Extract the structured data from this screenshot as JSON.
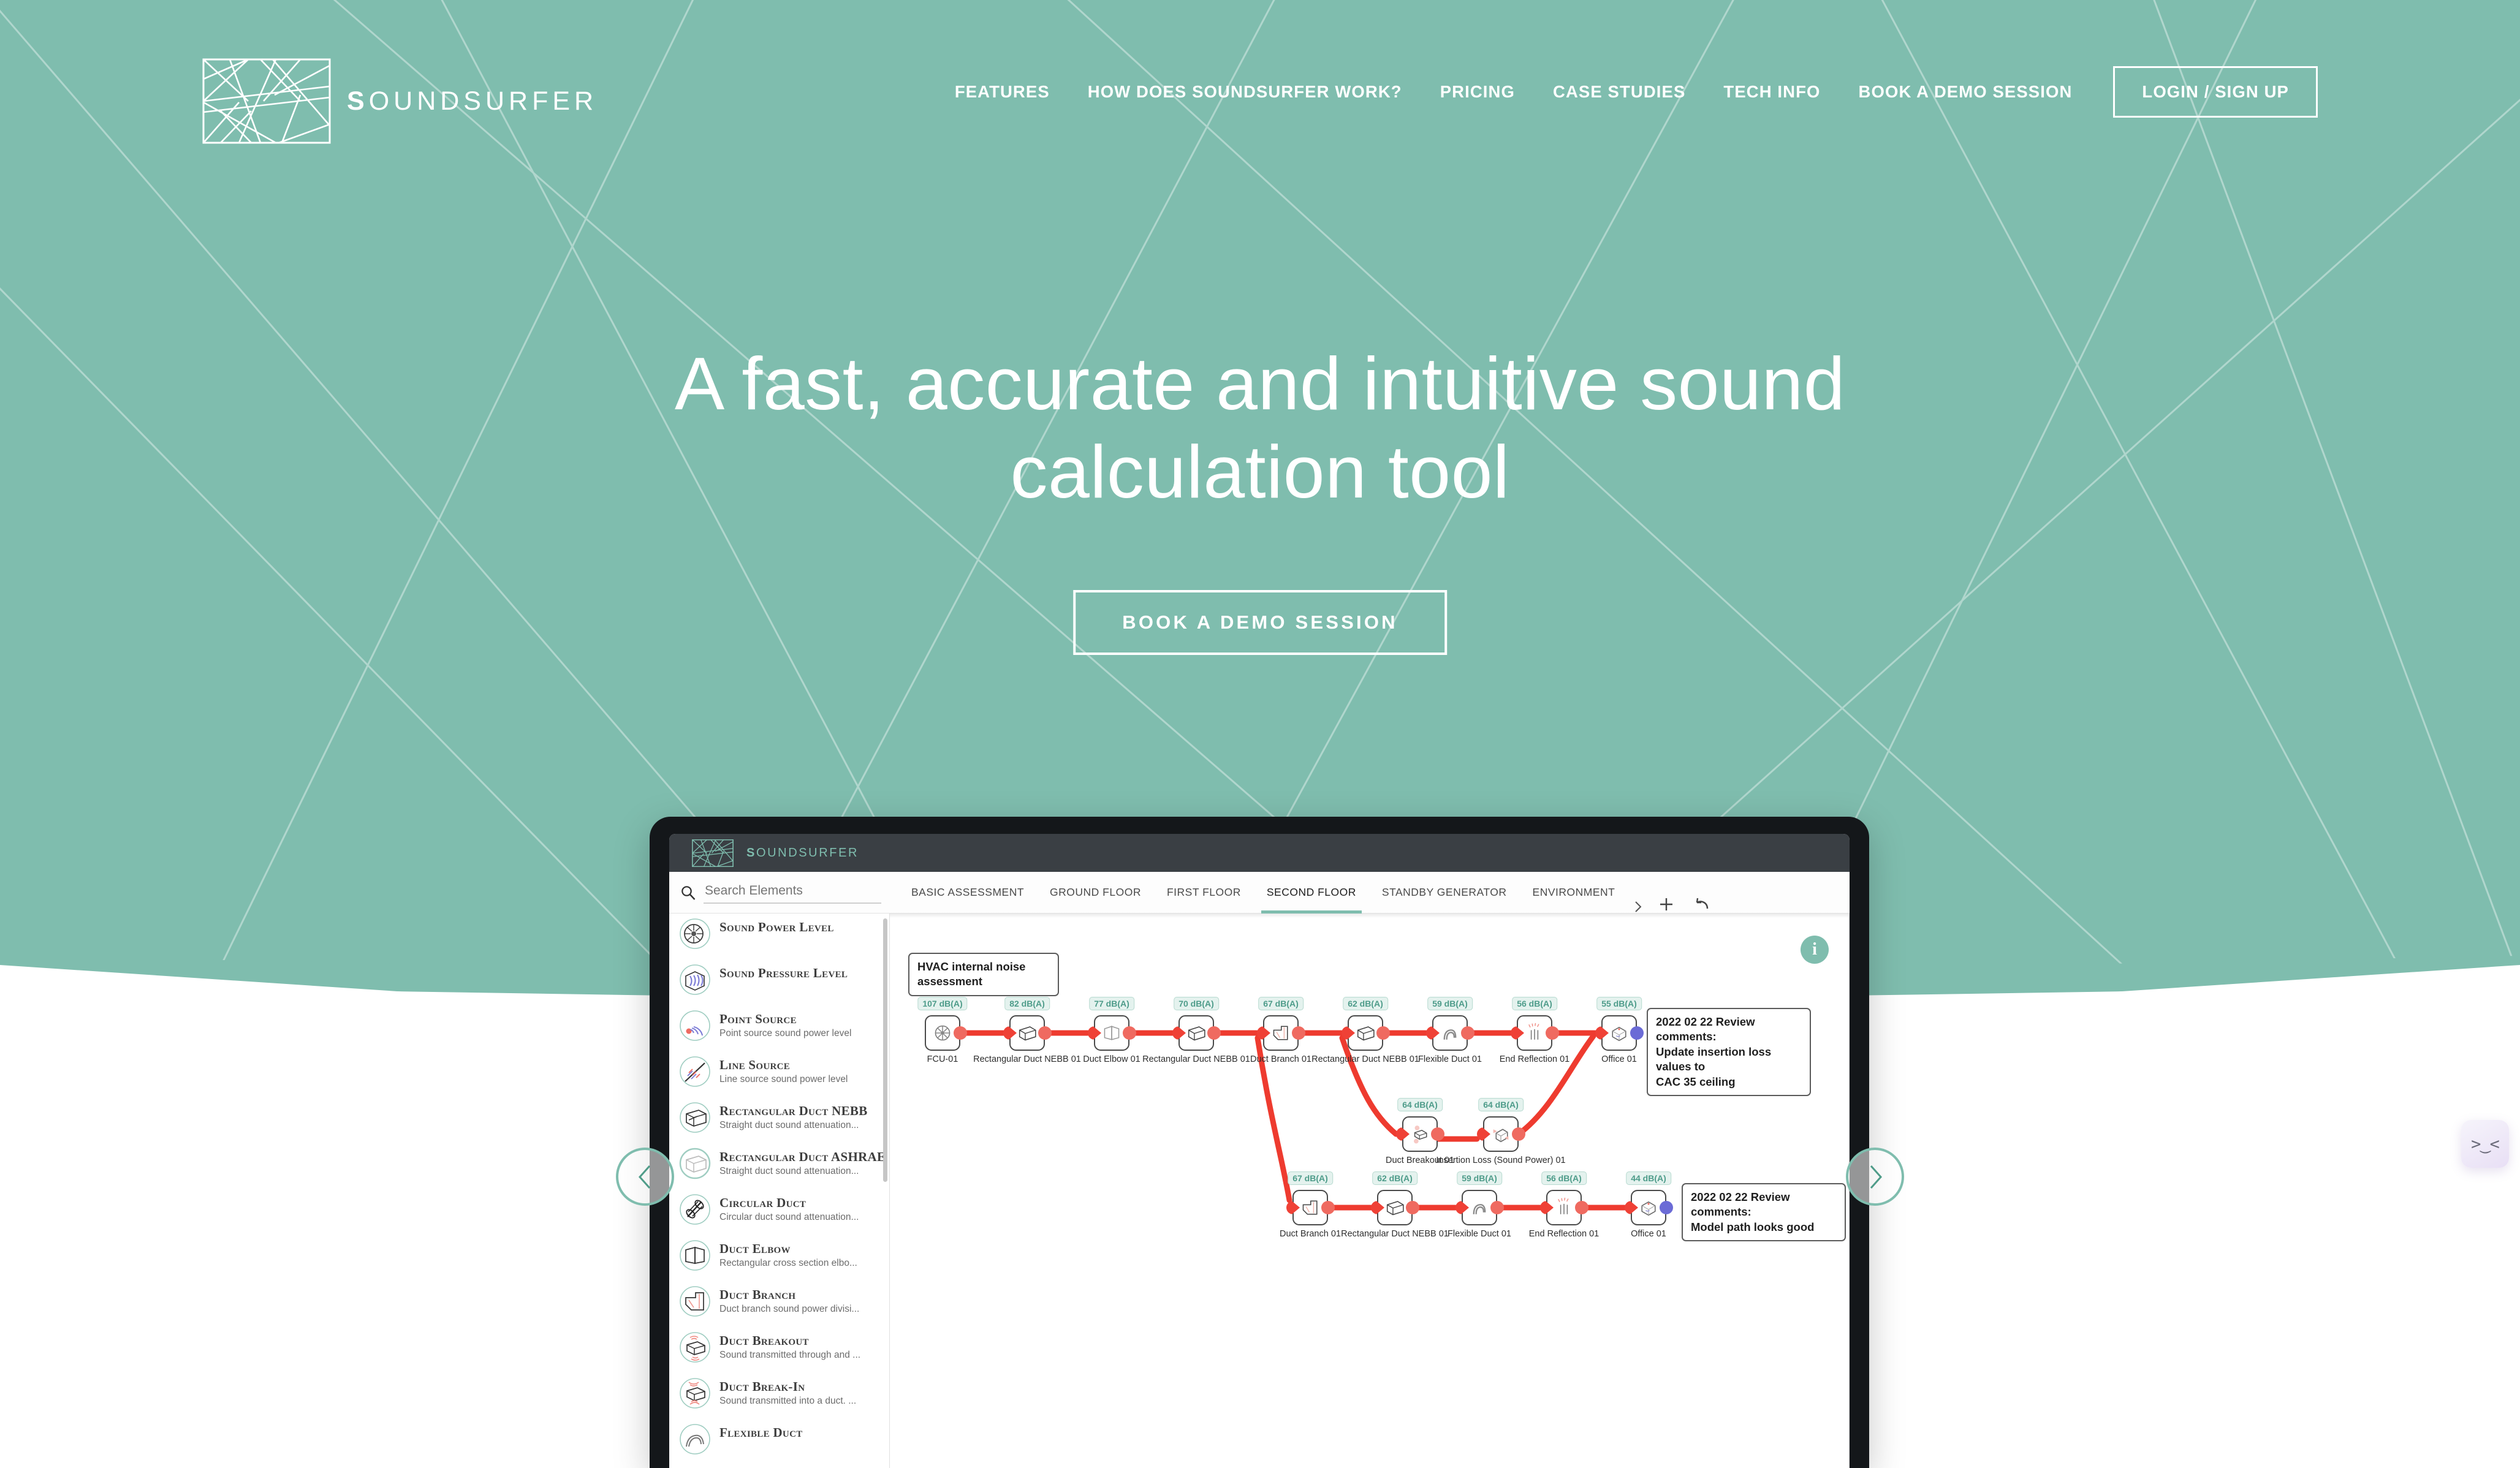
{
  "brand": {
    "name_light": "S",
    "name_rest": "OUNDSURFER",
    "full": "SOUNDSURFER",
    "mark": "geometric-lines-logo"
  },
  "nav": {
    "links": [
      {
        "label": "FEATURES",
        "name": "features"
      },
      {
        "label": "HOW DOES SOUNDSURFER WORK?",
        "name": "how-it-works"
      },
      {
        "label": "PRICING",
        "name": "pricing"
      },
      {
        "label": "CASE STUDIES",
        "name": "case-studies"
      },
      {
        "label": "TECH INFO",
        "name": "tech-info"
      },
      {
        "label": "BOOK A DEMO SESSION",
        "name": "book-demo"
      }
    ],
    "login_label": "LOGIN / SIGN UP"
  },
  "hero": {
    "title_line1": "A fast, accurate and intuitive sound",
    "title_line2": "calculation tool",
    "cta_label": "BOOK A DEMO SESSION",
    "bg_color": "#7FBDAE",
    "text_color": "#FFFFFF"
  },
  "carousel": {
    "prev_icon": "chevron-left-icon",
    "next_icon": "chevron-right-icon"
  },
  "chat_widget": {
    "glyph": ">‿<"
  },
  "app": {
    "header_brand_light": "S",
    "header_brand_rest": "OUNDSURFER",
    "accent": "#7FBDAE",
    "toolbar": {
      "search_placeholder": "Search Elements",
      "search_value": "",
      "add_label": "+",
      "undo_label": "undo-icon",
      "more_label": "chevron-right-icon"
    },
    "tabs": [
      {
        "label": "BASIC ASSESSMENT",
        "active": false
      },
      {
        "label": "GROUND FLOOR",
        "active": false
      },
      {
        "label": "FIRST FLOOR",
        "active": false
      },
      {
        "label": "SECOND FLOOR",
        "active": true
      },
      {
        "label": "STANDBY GENERATOR",
        "active": false
      },
      {
        "label": "ENVIRONMENT",
        "active": false
      }
    ],
    "sidebar": [
      {
        "title": "Sound Power Level",
        "desc": "",
        "icon": "fan-icon"
      },
      {
        "title": "Sound Pressure Level",
        "desc": "",
        "icon": "room-waves-icon"
      },
      {
        "title": "Point Source",
        "desc": "Point source sound power level",
        "icon": "point-source-icon"
      },
      {
        "title": "Line Source",
        "desc": "Line source sound power level",
        "icon": "line-source-icon"
      },
      {
        "title": "Rectangular Duct NEBB",
        "desc": "Straight duct sound attenuation...",
        "icon": "rect-duct-icon"
      },
      {
        "title": "Rectangular Duct ASHRAE",
        "desc": "Straight duct sound attenuation...",
        "icon": "rect-duct-icon"
      },
      {
        "title": "Circular Duct",
        "desc": "Circular duct sound attenuation...",
        "icon": "circular-duct-icon"
      },
      {
        "title": "Duct Elbow",
        "desc": "Rectangular cross section elbo...",
        "icon": "duct-elbow-icon"
      },
      {
        "title": "Duct Branch",
        "desc": "Duct branch sound power divisi...",
        "icon": "duct-branch-icon"
      },
      {
        "title": "Duct Breakout",
        "desc": "Sound transmitted through and ...",
        "icon": "duct-breakout-icon"
      },
      {
        "title": "Duct Break-In",
        "desc": "Sound transmitted into a duct. ...",
        "icon": "duct-breakin-icon"
      },
      {
        "title": "Flexible Duct",
        "desc": "",
        "icon": "flexible-duct-icon"
      }
    ],
    "canvas": {
      "title_note": "HVAC internal noise assessment",
      "info_icon": "info-icon",
      "comments": [
        {
          "text": "2022 02 22 Review comments:\nUpdate insertion loss values to\nCAC 35 ceiling"
        },
        {
          "text": "2022 02 22 Review comments:\nModel path looks good"
        }
      ],
      "chains": {
        "top": [
          {
            "label": "FCU-01",
            "value": "107 dB(A)",
            "icon": "fan-icon",
            "port_out": true
          },
          {
            "label": "Rectangular Duct NEBB 01",
            "value": "82 dB(A)",
            "icon": "rect-duct-icon",
            "port_out": true
          },
          {
            "label": "Duct Elbow 01",
            "value": "77 dB(A)",
            "icon": "duct-elbow-icon",
            "port_out": true
          },
          {
            "label": "Rectangular Duct NEBB 01",
            "value": "70 dB(A)",
            "icon": "rect-duct-icon",
            "port_out": true
          },
          {
            "label": "Duct Branch 01",
            "value": "67 dB(A)",
            "icon": "duct-branch-icon",
            "port_out": true
          },
          {
            "label": "Rectangular Duct NEBB 01",
            "value": "62 dB(A)",
            "icon": "rect-duct-icon",
            "port_out": true
          },
          {
            "label": "Flexible Duct 01",
            "value": "59 dB(A)",
            "icon": "flexible-duct-icon",
            "port_out": true
          },
          {
            "label": "End Reflection 01",
            "value": "56 dB(A)",
            "icon": "end-reflection-icon",
            "port_out": true
          },
          {
            "label": "Office 01",
            "value": "55 dB(A)",
            "icon": "room-icon",
            "port_out": false
          }
        ],
        "middle": [
          {
            "label": "Duct Breakout 01",
            "value": "64 dB(A)",
            "icon": "duct-breakout-icon",
            "port_out": true
          },
          {
            "label": "Insertion Loss (Sound Power) 01",
            "value": "64 dB(A)",
            "icon": "insertion-loss-icon",
            "port_out": true
          }
        ],
        "bottom": [
          {
            "label": "Duct Branch 01",
            "value": "67 dB(A)",
            "icon": "duct-branch-icon",
            "port_out": true
          },
          {
            "label": "Rectangular Duct NEBB 01",
            "value": "62 dB(A)",
            "icon": "rect-duct-icon",
            "port_out": true
          },
          {
            "label": "Flexible Duct 01",
            "value": "59 dB(A)",
            "icon": "flexible-duct-icon",
            "port_out": true
          },
          {
            "label": "End Reflection 01",
            "value": "56 dB(A)",
            "icon": "end-reflection-icon",
            "port_out": true
          },
          {
            "label": "Office 01",
            "value": "44 dB(A)",
            "icon": "room-icon",
            "port_out": false
          }
        ]
      }
    }
  }
}
